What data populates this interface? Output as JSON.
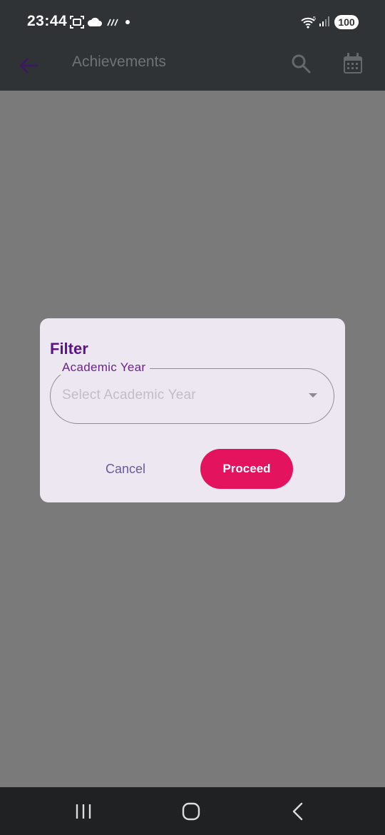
{
  "status_bar": {
    "time": "23:44",
    "battery": "100",
    "icons": [
      "screenshot-icon",
      "cloud-icon",
      "weather-icon",
      "notification-dot-icon",
      "wifi-icon",
      "signal-icon"
    ]
  },
  "app_bar": {
    "title": "Achievements",
    "icons": [
      "back-arrow-icon",
      "search-icon",
      "calendar-icon"
    ]
  },
  "dialog": {
    "title": "Filter",
    "academic_year": {
      "label": "Academic Year",
      "placeholder": "Select Academic Year"
    },
    "cancel_label": "Cancel",
    "proceed_label": "Proceed"
  },
  "colors": {
    "accent_purple": "#5a1586",
    "proceed_pink": "#e3135d",
    "cancel_text": "#6a5a99",
    "scrim": "#7a7a7a"
  },
  "nav_bar": {
    "icons": [
      "recents-icon",
      "home-icon",
      "back-icon"
    ]
  }
}
